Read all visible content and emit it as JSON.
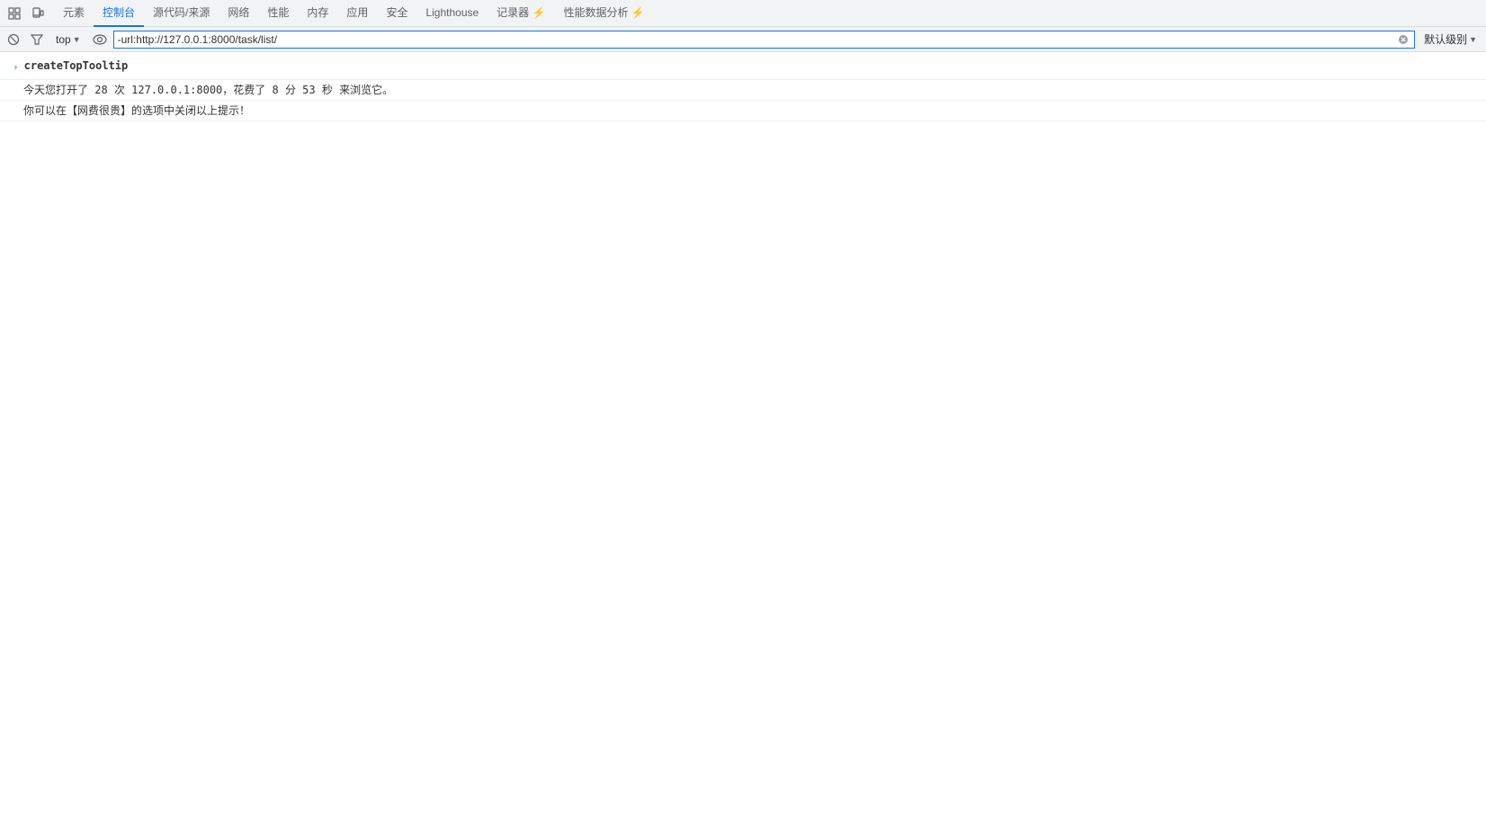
{
  "toolbar": {
    "nav_tabs": [
      {
        "label": "元素",
        "active": false
      },
      {
        "label": "控制台",
        "active": true
      },
      {
        "label": "源代码/来源",
        "active": false
      },
      {
        "label": "网络",
        "active": false
      },
      {
        "label": "性能",
        "active": false
      },
      {
        "label": "内存",
        "active": false
      },
      {
        "label": "应用",
        "active": false
      },
      {
        "label": "安全",
        "active": false
      },
      {
        "label": "Lighthouse",
        "active": false
      },
      {
        "label": "记录器 ⚡",
        "active": false
      },
      {
        "label": "性能数据分析 ⚡",
        "active": false
      }
    ]
  },
  "console_toolbar": {
    "context_label": "top",
    "filter_value": "-url:http://127.0.0.1:8000/task/list/",
    "level_label": "默认级别"
  },
  "console_output": {
    "entries": [
      {
        "type": "title",
        "text": "createTopTooltip"
      },
      {
        "type": "info",
        "text": "今天您打开了 28 次 127.0.0.1:8000，花费了 8 分 53 秒 来浏览它。"
      },
      {
        "type": "info",
        "text": "你可以在【网费很贵】的选项中关闭以上提示！"
      }
    ]
  }
}
